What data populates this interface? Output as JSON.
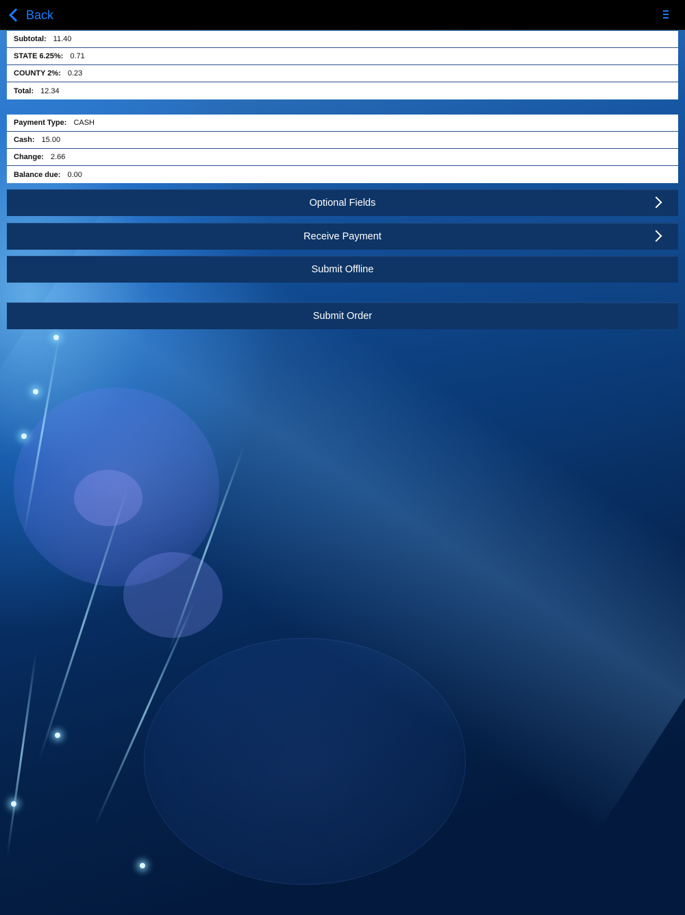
{
  "nav": {
    "back_label": "Back"
  },
  "totals": [
    {
      "label": "Subtotal:",
      "value": "11.40"
    },
    {
      "label": "STATE 6.25%:",
      "value": "0.71"
    },
    {
      "label": "COUNTY 2%:",
      "value": "0.23"
    },
    {
      "label": "Total:",
      "value": "12.34"
    }
  ],
  "payment": [
    {
      "label": "Payment Type:",
      "value": "CASH"
    },
    {
      "label": "Cash:",
      "value": "15.00"
    },
    {
      "label": "Change:",
      "value": "2.66"
    },
    {
      "label": "Balance due:",
      "value": "0.00"
    }
  ],
  "actions": {
    "optional_fields": "Optional Fields",
    "receive_payment": "Receive Payment",
    "submit_offline": "Submit Offline",
    "submit_order": "Submit Order"
  },
  "colors": {
    "nav_bg": "#000000",
    "accent": "#1a7cff",
    "button_bg": "#0e3566",
    "row_bg": "#ffffff"
  },
  "icons": {
    "back": "chevron-left-icon",
    "menu": "menu-icon",
    "disclosure": "chevron-right-icon"
  }
}
